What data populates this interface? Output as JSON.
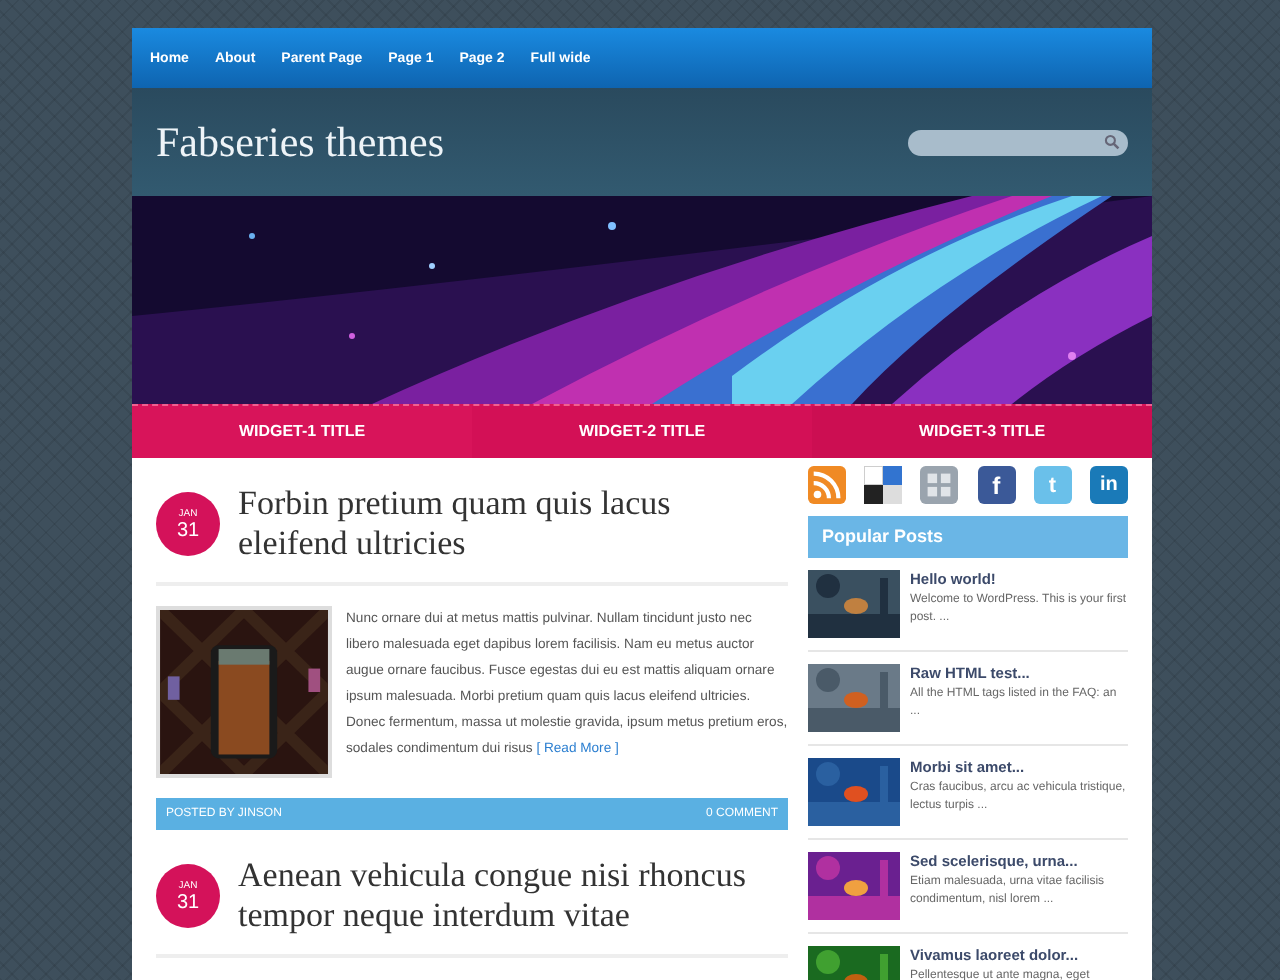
{
  "nav": [
    "Home",
    "About",
    "Parent Page",
    "Page 1",
    "Page 2",
    "Full wide"
  ],
  "site_title": "Fabseries themes",
  "widgets": [
    "WIDGET-1 TITLE",
    "WIDGET-2 TITLE",
    "WIDGET-3 TITLE"
  ],
  "posts": [
    {
      "month": "JAN",
      "day": "31",
      "title": "Forbin pretium quam quis lacus eleifend ultricies",
      "excerpt": "Nunc ornare dui at metus mattis pulvinar. Nullam tincidunt justo nec libero malesuada eget dapibus lorem facilisis. Nam eu metus auctor augue ornare faucibus. Fusce egestas dui eu est mattis aliquam ornare ipsum malesuada. Morbi pretium quam quis lacus eleifend ultricies. Donec fermentum, massa ut molestie gravida, ipsum metus pretium eros, sodales condimentum dui risus",
      "read_more": "[ Read More ]",
      "author": "POSTED BY JINSON",
      "comments": "0 COMMENT"
    },
    {
      "month": "JAN",
      "day": "31",
      "title": "Aenean vehicula congue nisi rhoncus tempor neque interdum vitae"
    }
  ],
  "social": [
    {
      "kind": "rss"
    },
    {
      "kind": "delicious"
    },
    {
      "kind": "grid"
    },
    {
      "kind": "facebook",
      "glyph": "f"
    },
    {
      "kind": "twitter",
      "glyph": "t"
    },
    {
      "kind": "linkedin",
      "glyph": "in"
    }
  ],
  "popular": {
    "title": "Popular Posts",
    "items": [
      {
        "title": "Hello world!",
        "excerpt": "Welcome to WordPress. This is your first post. ..."
      },
      {
        "title": "Raw HTML test...",
        "excerpt": "All the HTML tags listed in the FAQ: an ..."
      },
      {
        "title": "Morbi sit amet...",
        "excerpt": "Cras faucibus, arcu ac vehicula tristique, lectus turpis ..."
      },
      {
        "title": "Sed scelerisque, urna...",
        "excerpt": "Etiam malesuada, urna vitae facilisis condimentum, nisl lorem ..."
      },
      {
        "title": "Vivamus laoreet dolor...",
        "excerpt": "Pellentesque ut ante magna, eget"
      }
    ]
  }
}
